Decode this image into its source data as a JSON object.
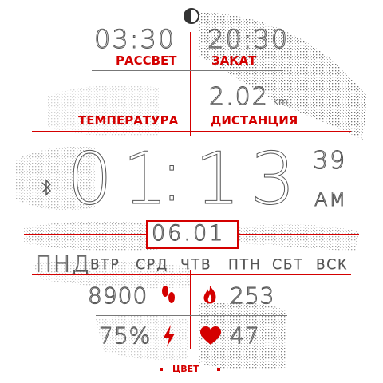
{
  "sun": {
    "sunrise_time": "03:30",
    "sunrise_label": "РАССВЕТ",
    "sunset_time": "20:30",
    "sunset_label": "ЗАКАТ"
  },
  "left_metric": {
    "label": "ТЕМПЕРАТУРА"
  },
  "distance": {
    "value": "2.02",
    "unit": "km",
    "label": "ДИСТАНЦИЯ"
  },
  "time": {
    "hours": "01",
    "colon": ":",
    "minutes": "13",
    "seconds": "39",
    "ampm": "AM"
  },
  "date": {
    "value": "06.01"
  },
  "weekdays": {
    "current": "ПНД",
    "others": [
      "ВТР",
      "СРД",
      "ЧТВ",
      "ПТН",
      "СБТ",
      "ВСК"
    ]
  },
  "stats": {
    "steps": "8900",
    "calories": "253",
    "battery": "75%",
    "heart_rate": "47"
  },
  "footer": {
    "color_button": "ЦВЕТ"
  },
  "colors": {
    "accent": "#d40000",
    "outline": "#555555",
    "background": "#ffffff"
  },
  "icons": [
    "moon-phase-icon",
    "bluetooth-icon",
    "footprints-icon",
    "flame-icon",
    "lightning-icon",
    "heart-icon"
  ]
}
